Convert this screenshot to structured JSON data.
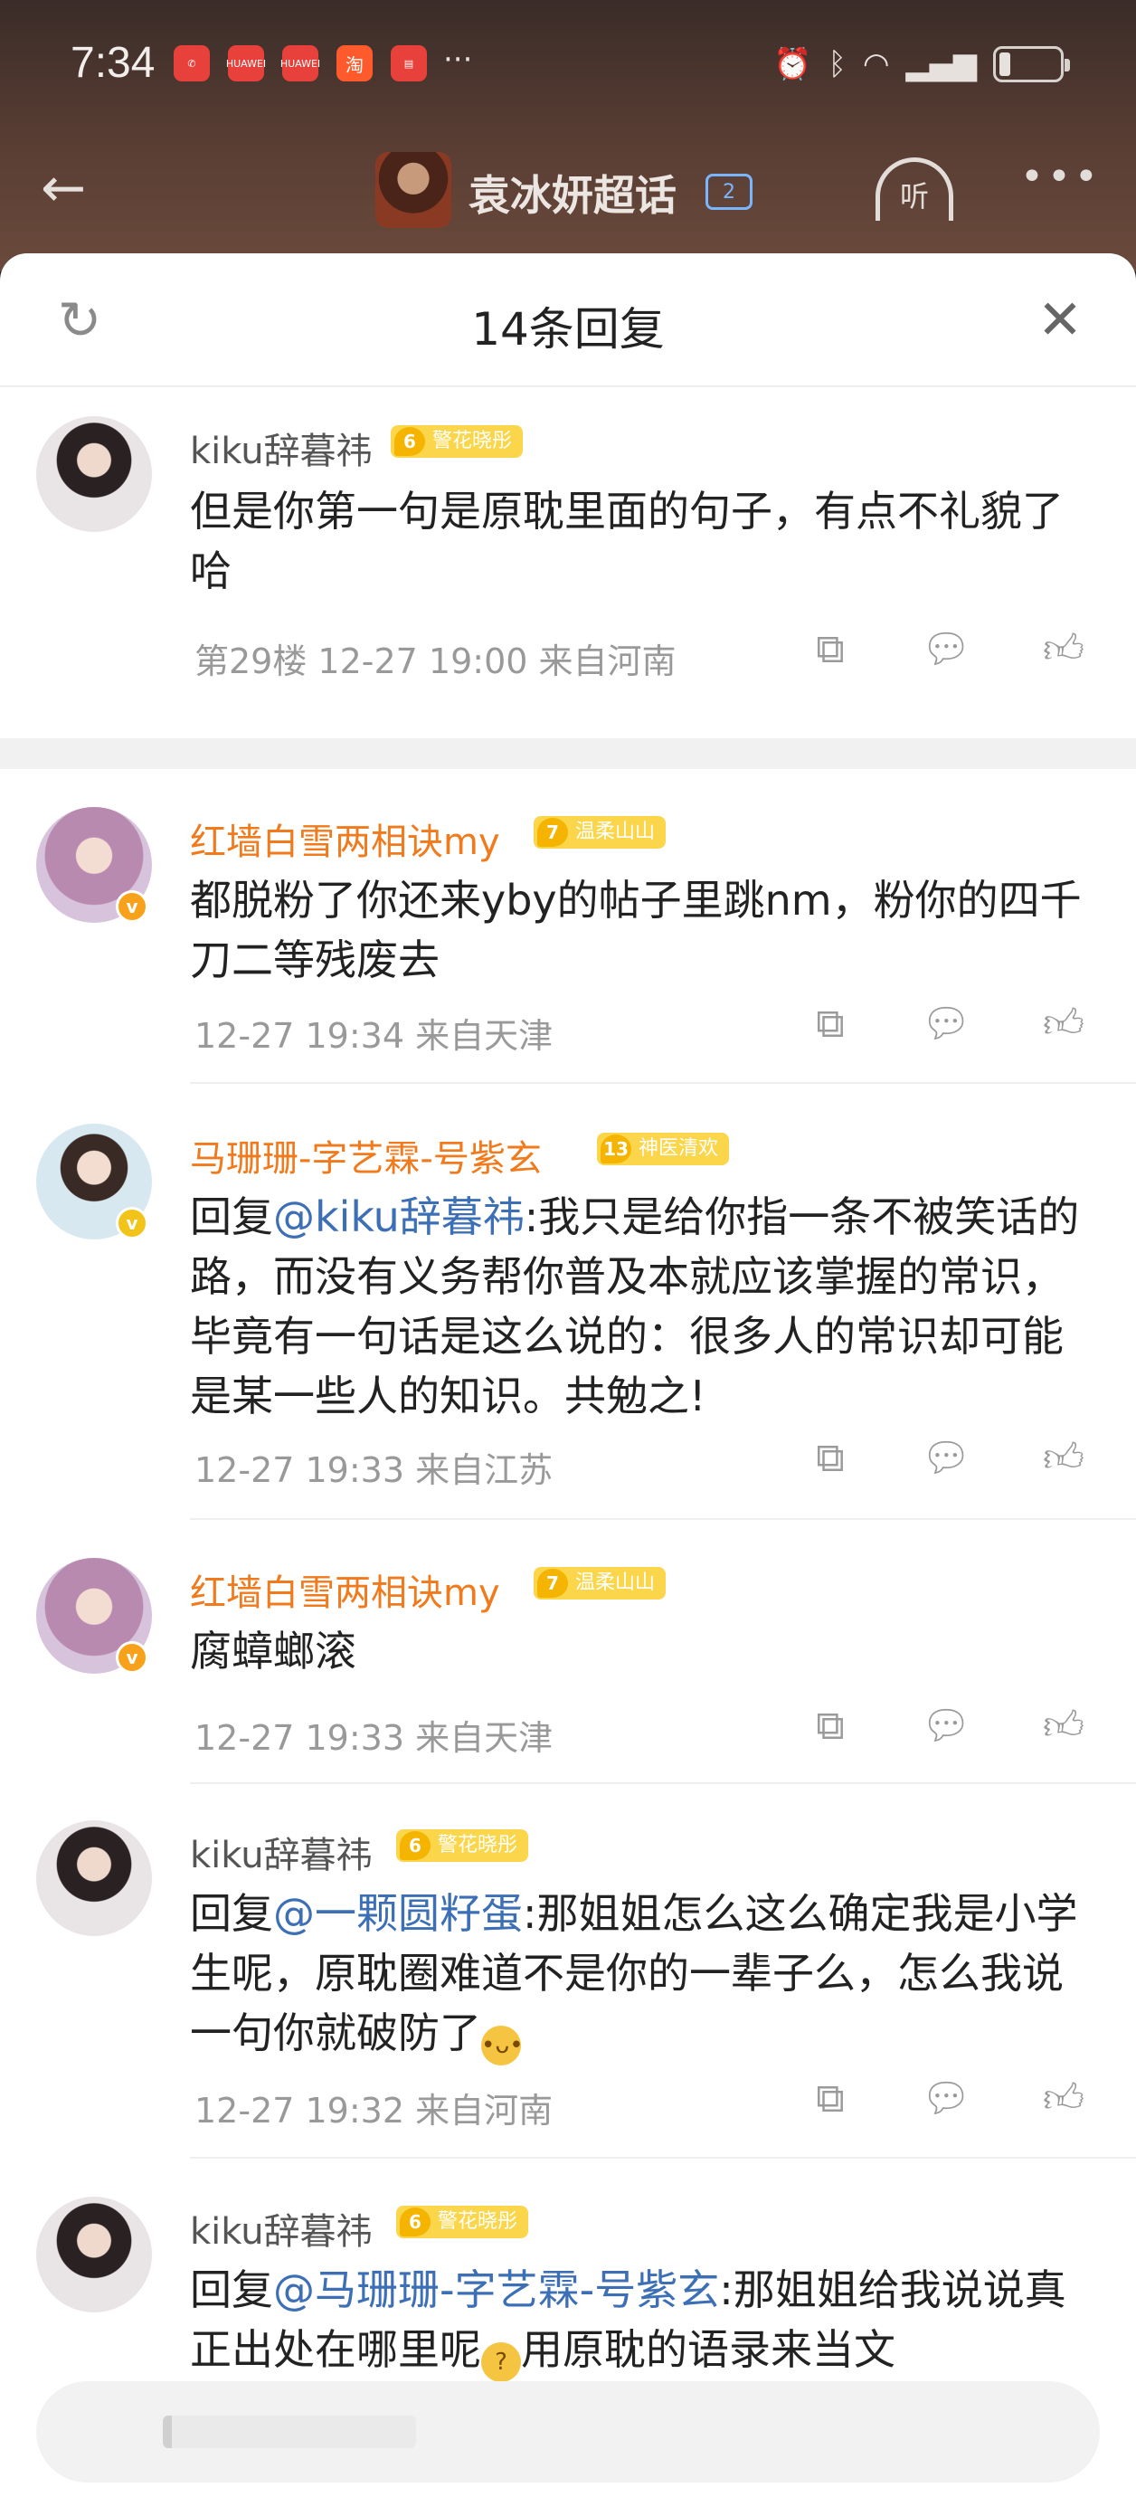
{
  "status_bar": {
    "time": "7:34",
    "notifications": [
      "phone-missed",
      "huawei",
      "huawei",
      "taobao",
      "book"
    ],
    "more": "···",
    "huawei_label": "HUAWEI",
    "taobao_label": "淘"
  },
  "header": {
    "topic_title": "袁冰妍超话",
    "topic_badge": "2",
    "listen_label": "听",
    "more": "•••"
  },
  "sheet": {
    "title": "14条回复"
  },
  "replies": [
    {
      "username": "kiku辞暮祎",
      "fan_level": "6",
      "fan_title": "警花晓彤",
      "content": "但是你第一句是原耽里面的句子，有点不礼貌了哈",
      "meta": "第29楼 12-27 19:00 来自河南"
    },
    {
      "username": "红墙白雪两相诀my",
      "fan_level": "7",
      "fan_title": "温柔山山",
      "content": "都脱粉了你还来yby的帖子里跳nm，粉你的四千刀二等残废去",
      "meta": "12-27 19:34 来自天津"
    },
    {
      "username": "马珊珊-字艺霖-号紫玄",
      "fan_level": "13",
      "fan_title": "神医清欢",
      "content_prefix": "回复",
      "mention": "@kiku辞暮祎",
      "content": ":我只是给你指一条不被笑话的路，而没有义务帮你普及本就应该掌握的常识，毕竟有一句话是这么说的：很多人的常识却可能是某一些人的知识。共勉之!",
      "meta": "12-27 19:33 来自江苏"
    },
    {
      "username": "红墙白雪两相诀my",
      "fan_level": "7",
      "fan_title": "温柔山山",
      "content": "腐蟑螂滚",
      "meta": "12-27 19:33 来自天津"
    },
    {
      "username": "kiku辞暮祎",
      "fan_level": "6",
      "fan_title": "警花晓彤",
      "content_prefix": "回复",
      "mention": "@一颗圆籽蛋",
      "content": ":那姐姐怎么这么确定我是小学生呢，原耽圈难道不是你的一辈子么，怎么我说一句你就破防了",
      "meta": "12-27 19:32 来自河南"
    },
    {
      "username": "kiku辞暮祎",
      "fan_level": "6",
      "fan_title": "警花晓彤",
      "content_prefix": "回复",
      "mention": "@马珊珊-字艺霖-号紫玄",
      "content": ":那姐姐给我说说真正出处在哪里呢",
      "content_tail": "用原耽的语录来当文"
    }
  ],
  "icons": {
    "back": "back-arrow-icon",
    "refresh": "refresh-icon",
    "close": "close-icon",
    "share": "share-icon",
    "comment": "comment-icon",
    "like": "like-icon"
  },
  "colors": {
    "orange_username": "#f07a1c",
    "mention": "#3c6fb5",
    "meta": "#999999",
    "badge": "#fbd54a"
  }
}
